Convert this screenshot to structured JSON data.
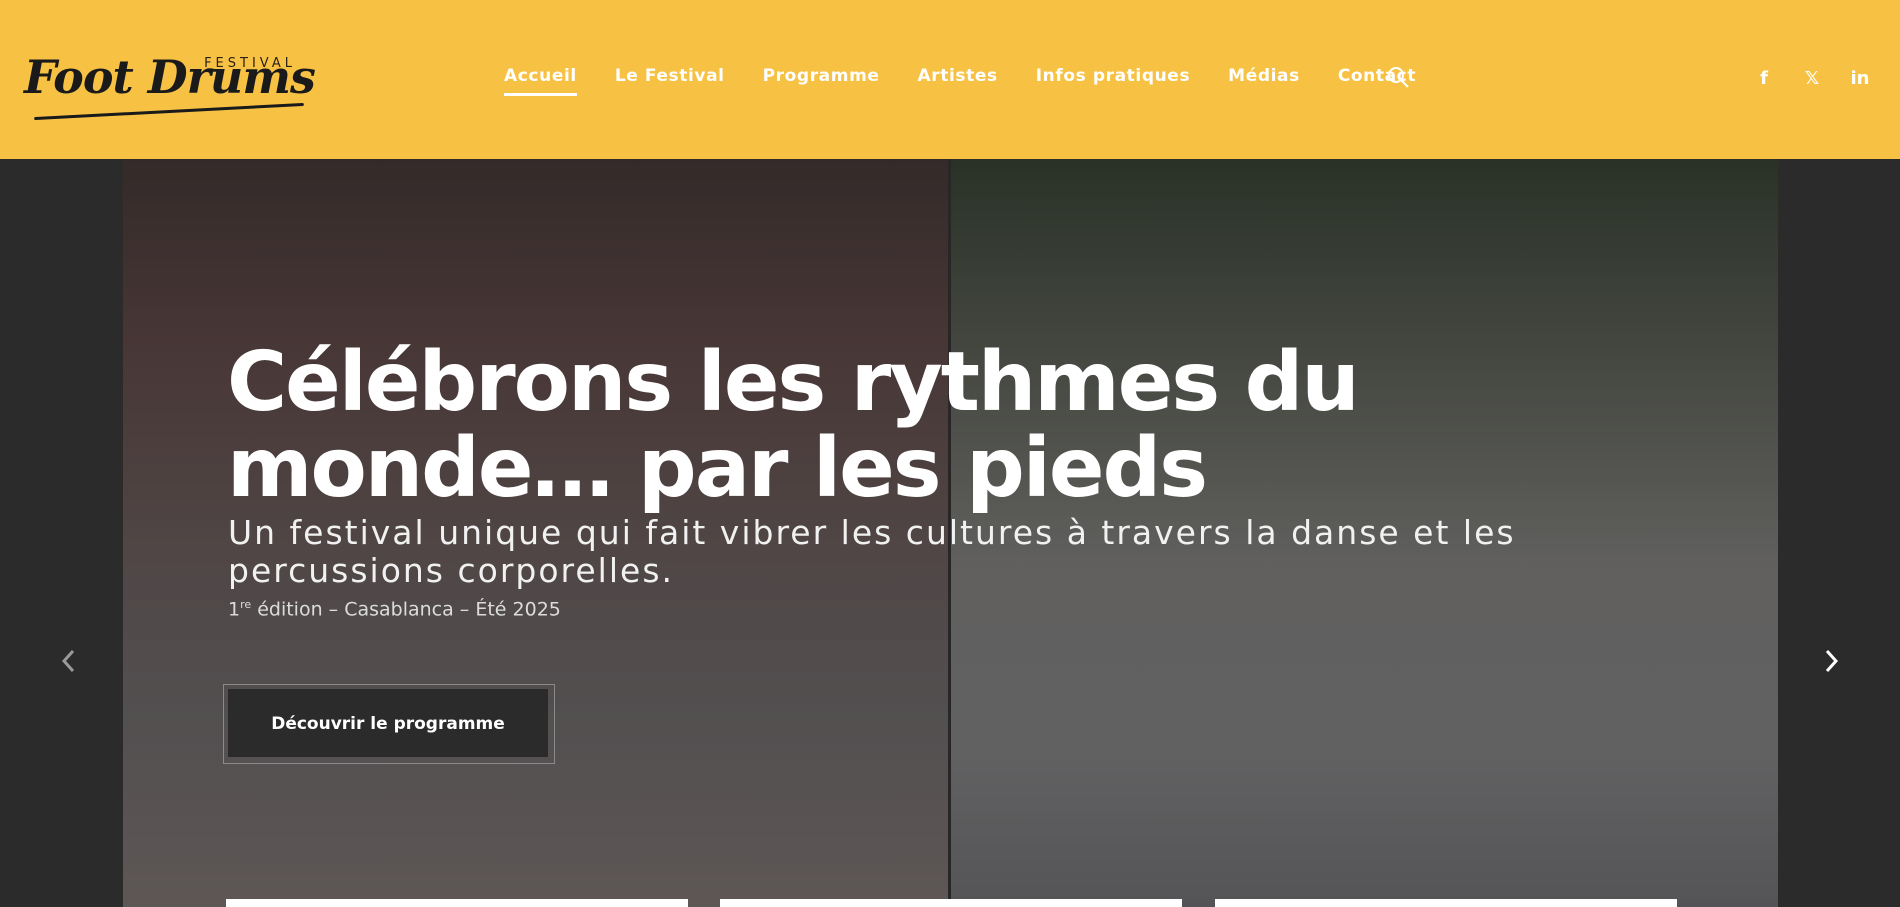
{
  "header": {
    "logo": {
      "top_text": "FESTIVAL",
      "script_text": "Foot Drums"
    },
    "nav": [
      {
        "label": "Accueil",
        "active": true
      },
      {
        "label": "Le Festival",
        "active": false
      },
      {
        "label": "Programme",
        "active": false
      },
      {
        "label": "Artistes",
        "active": false
      },
      {
        "label": "Infos pratiques",
        "active": false
      },
      {
        "label": "Médias",
        "active": false
      },
      {
        "label": "Contact",
        "active": false
      }
    ],
    "search_icon": "search-icon",
    "social": [
      {
        "icon": "facebook-icon",
        "glyph": "f"
      },
      {
        "icon": "x-icon",
        "glyph": "𝕏"
      },
      {
        "icon": "linkedin-icon",
        "glyph": "in"
      }
    ]
  },
  "hero": {
    "title": "Célébrons les rythmes du monde… par les pieds",
    "subtitle": "Un festival unique qui fait vibrer les cultures à travers la danse et les percussions corporelles.",
    "edition_num": "1",
    "edition_sup": "re",
    "edition_rest": " édition – Casablanca – Été 2025",
    "cta_label": "Découvrir le programme",
    "prev_icon": "chevron-left-icon",
    "next_icon": "chevron-right-icon"
  },
  "colors": {
    "header_bg": "#f7c244",
    "page_bg": "#2b2b2b",
    "text": "#ffffff"
  }
}
